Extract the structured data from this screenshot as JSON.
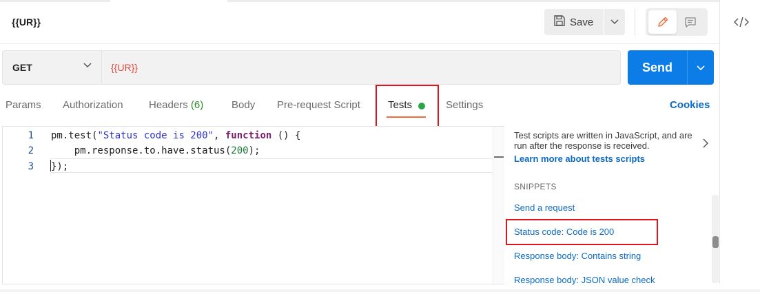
{
  "header": {
    "request_title": "{{UR}}",
    "save_label": "Save"
  },
  "request": {
    "method": "GET",
    "url": "{{UR}}",
    "send_label": "Send"
  },
  "tabs": [
    {
      "label": "Params"
    },
    {
      "label": "Authorization"
    },
    {
      "label": "Headers",
      "count": "(6)"
    },
    {
      "label": "Body"
    },
    {
      "label": "Pre-request Script"
    },
    {
      "label": "Tests",
      "active": true
    },
    {
      "label": "Settings"
    }
  ],
  "cookies_label": "Cookies",
  "editor": {
    "line_numbers": [
      "1",
      "2",
      "3"
    ],
    "lines": [
      "pm.test(\"Status code is 200\", function () {",
      "    pm.response.to.have.status(200);",
      "});"
    ]
  },
  "snippets_pane": {
    "help_text": "Test scripts are written in JavaScript, and are run after the response is received.",
    "help_link": "Learn more about tests scripts",
    "heading": "SNIPPETS",
    "items": [
      "Send a request",
      "Status code: Code is 200",
      "Response body: Contains string",
      "Response body: JSON value check"
    ]
  },
  "icons": {
    "save": "save-disk-icon",
    "edit": "pencil-icon",
    "comment": "comment-icon",
    "code": "code-icon"
  },
  "colors": {
    "send_button": "#0c7ce6",
    "active_tab_underline": "#f26b3a",
    "tests_dot": "#28a745",
    "link": "#0b6ac5",
    "highlight_box": "#e0141a",
    "url_variable": "#e0473b"
  }
}
